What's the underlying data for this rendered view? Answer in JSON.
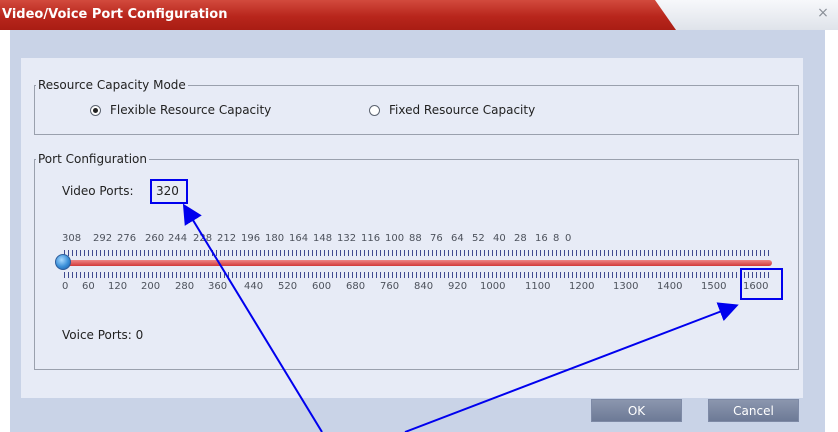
{
  "window": {
    "title": "Video/Voice Port Configuration",
    "close_glyph": "×"
  },
  "resource_mode": {
    "legend": "Resource Capacity Mode",
    "options": [
      {
        "label": "Flexible Resource Capacity",
        "selected": true
      },
      {
        "label": "Fixed Resource Capacity",
        "selected": false
      }
    ]
  },
  "port_config": {
    "legend": "Port Configuration",
    "video_label": "Video Ports:",
    "video_value": "320",
    "voice_label": "Voice Ports: 0",
    "top_ticks": [
      "308",
      "292",
      "276",
      "260",
      "244",
      "228",
      "212",
      "196",
      "180",
      "164",
      "148",
      "132",
      "116",
      "100",
      "88",
      "76",
      "64",
      "52",
      "40",
      "28",
      "16",
      "8",
      "0"
    ],
    "bottom_ticks": [
      "0",
      "60",
      "120",
      "200",
      "280",
      "360",
      "440",
      "520",
      "600",
      "680",
      "760",
      "840",
      "920",
      "1000",
      "1100",
      "1200",
      "1300",
      "1400",
      "1500",
      "1600"
    ],
    "slider_value": 0
  },
  "buttons": {
    "ok": "OK",
    "cancel": "Cancel"
  },
  "colors": {
    "title_red": "#b8261c",
    "highlight_blue": "#0000ee",
    "slider_track": "#e05050"
  }
}
